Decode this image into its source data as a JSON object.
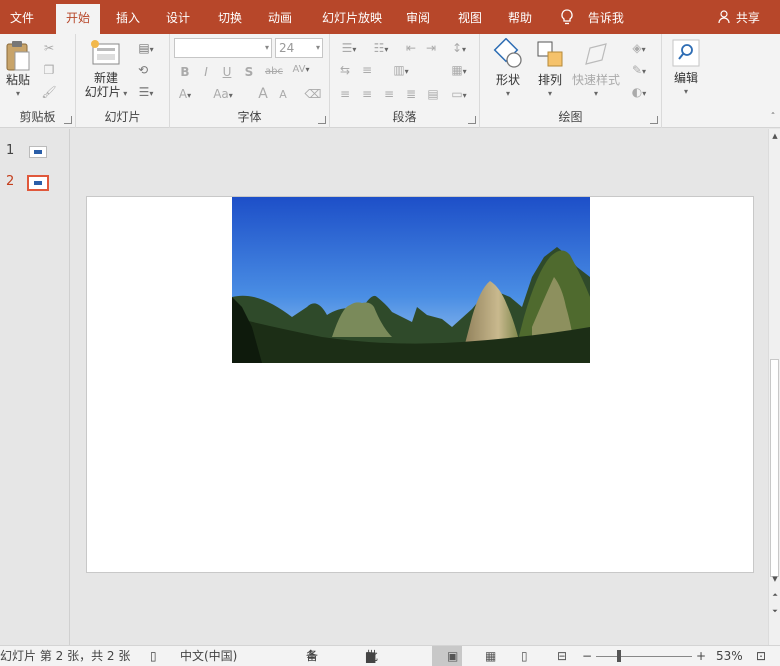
{
  "menubar": {
    "tabs": [
      "文件",
      "开始",
      "插入",
      "设计",
      "切换",
      "动画",
      "幻灯片放映",
      "审阅",
      "视图",
      "帮助"
    ],
    "active_tab": "开始",
    "tell_me": "告诉我",
    "share": "共享"
  },
  "ribbon": {
    "clipboard": {
      "label": "剪贴板",
      "paste": "粘贴"
    },
    "slides": {
      "label": "幻灯片",
      "new_slide_line1": "新建",
      "new_slide_line2": "幻灯片"
    },
    "font": {
      "label": "字体",
      "font_name": "",
      "font_size": "24",
      "bold": "B",
      "italic": "I",
      "underline": "U",
      "shadow": "S",
      "strike": "abc",
      "spacing": "AV",
      "case": "Aa",
      "grow": "A",
      "shrink": "A"
    },
    "paragraph": {
      "label": "段落"
    },
    "drawing": {
      "label": "绘图",
      "shapes": "形状",
      "arrange": "排列",
      "quick_styles": "快速样式"
    },
    "editing": {
      "label": "编辑"
    }
  },
  "thumbnails": {
    "slides": [
      {
        "number": "1"
      },
      {
        "number": "2"
      }
    ],
    "active_slide": "2"
  },
  "statusbar": {
    "slide_info": "幻灯片 第 2 张，共 2 张",
    "language": "中文(中国)",
    "notes": "备注",
    "comments": "批注",
    "zoom": "53%"
  },
  "colors": {
    "accent": "#b7472a",
    "active_thumb_border": "#e0583b"
  }
}
